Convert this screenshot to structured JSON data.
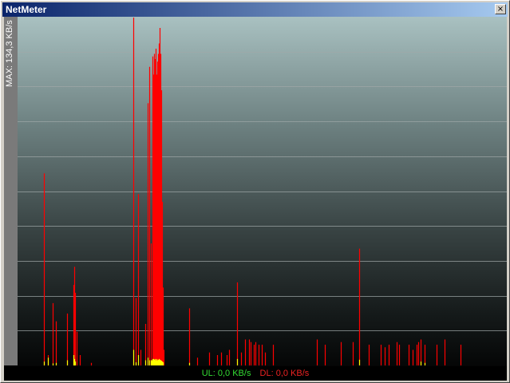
{
  "window": {
    "title": "NetMeter",
    "close_label": "×"
  },
  "graph": {
    "max_label": "MAX: 134,3 KB/s",
    "max_value": 134.3,
    "gridline_count": 10,
    "colors": {
      "download": "#ff0000",
      "upload": "#ffff00",
      "grid": "#a0a8a8"
    }
  },
  "status": {
    "ul_label": "UL: 0,0 KB/s",
    "dl_label": "DL: 0,0 KB/s"
  },
  "chart_data": {
    "type": "bar",
    "ylim": [
      0,
      134.3
    ],
    "series": [
      {
        "name": "DL",
        "points": [
          [
            33,
            74
          ],
          [
            38,
            4
          ],
          [
            44,
            24
          ],
          [
            48,
            17
          ],
          [
            62,
            20
          ],
          [
            70,
            31
          ],
          [
            71,
            38
          ],
          [
            72,
            28
          ],
          [
            74,
            13
          ],
          [
            78,
            4
          ],
          [
            92,
            1
          ],
          [
            145,
            134
          ],
          [
            148,
            26
          ],
          [
            151,
            66
          ],
          [
            154,
            6
          ],
          [
            160,
            16
          ],
          [
            163,
            101
          ],
          [
            165,
            115
          ],
          [
            167,
            47
          ],
          [
            169,
            119
          ],
          [
            170,
            112
          ],
          [
            171,
            120
          ],
          [
            172,
            118
          ],
          [
            173,
            122
          ],
          [
            174,
            112
          ],
          [
            175,
            117
          ],
          [
            176,
            120
          ],
          [
            177,
            124
          ],
          [
            178,
            130
          ],
          [
            179,
            120
          ],
          [
            180,
            106
          ],
          [
            181,
            63
          ],
          [
            182,
            30
          ],
          [
            183,
            6
          ],
          [
            215,
            22
          ],
          [
            225,
            3
          ],
          [
            240,
            5
          ],
          [
            250,
            4
          ],
          [
            255,
            5
          ],
          [
            262,
            4
          ],
          [
            265,
            6
          ],
          [
            275,
            32
          ],
          [
            280,
            5
          ],
          [
            285,
            10
          ],
          [
            290,
            10
          ],
          [
            292,
            9
          ],
          [
            296,
            8
          ],
          [
            298,
            9
          ],
          [
            302,
            8
          ],
          [
            306,
            8
          ],
          [
            310,
            5
          ],
          [
            320,
            8
          ],
          [
            375,
            10
          ],
          [
            385,
            8
          ],
          [
            405,
            9
          ],
          [
            420,
            9
          ],
          [
            428,
            45
          ],
          [
            440,
            8
          ],
          [
            455,
            8
          ],
          [
            460,
            7
          ],
          [
            465,
            8
          ],
          [
            475,
            9
          ],
          [
            478,
            8
          ],
          [
            490,
            8
          ],
          [
            495,
            6
          ],
          [
            500,
            8
          ],
          [
            502,
            9
          ],
          [
            505,
            10
          ],
          [
            510,
            8
          ],
          [
            525,
            8
          ],
          [
            535,
            10
          ],
          [
            555,
            8
          ]
        ]
      },
      {
        "name": "UL",
        "points": [
          [
            33,
            1.5
          ],
          [
            38,
            3
          ],
          [
            44,
            0.8
          ],
          [
            48,
            1
          ],
          [
            62,
            2
          ],
          [
            70,
            4
          ],
          [
            71,
            2.5
          ],
          [
            72,
            1.5
          ],
          [
            145,
            6
          ],
          [
            148,
            1.2
          ],
          [
            151,
            4
          ],
          [
            160,
            2
          ],
          [
            163,
            3
          ],
          [
            165,
            2
          ],
          [
            167,
            2
          ],
          [
            168,
            2
          ],
          [
            169,
            2.5
          ],
          [
            170,
            2.5
          ],
          [
            171,
            2.2
          ],
          [
            172,
            2.5
          ],
          [
            173,
            2
          ],
          [
            174,
            2.5
          ],
          [
            175,
            2
          ],
          [
            176,
            2.2
          ],
          [
            177,
            2.5
          ],
          [
            178,
            2.2
          ],
          [
            179,
            2
          ],
          [
            180,
            1.8
          ],
          [
            181,
            1.5
          ],
          [
            182,
            1.2
          ],
          [
            215,
            1
          ],
          [
            275,
            2.5
          ],
          [
            428,
            2.2
          ],
          [
            505,
            1.5
          ],
          [
            510,
            1
          ]
        ]
      }
    ]
  }
}
